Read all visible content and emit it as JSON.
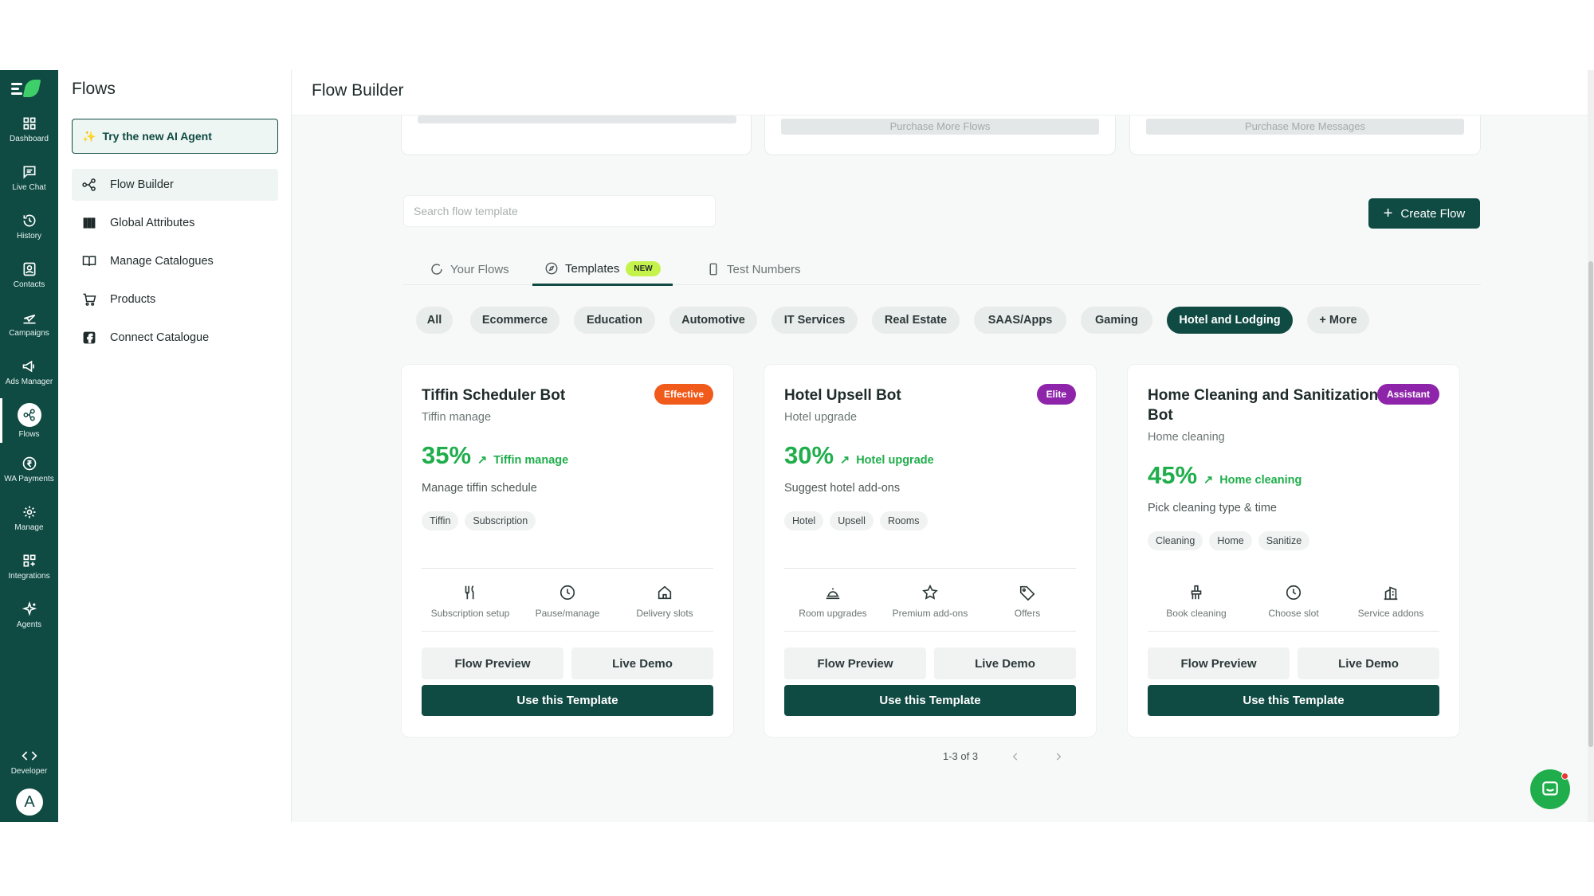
{
  "rail": {
    "items": [
      {
        "label": "Dashboard",
        "icon": "grid-icon"
      },
      {
        "label": "Live Chat",
        "icon": "chat-icon"
      },
      {
        "label": "History",
        "icon": "history-icon"
      },
      {
        "label": "Contacts",
        "icon": "contacts-icon"
      },
      {
        "label": "Campaigns",
        "icon": "send-icon"
      },
      {
        "label": "Ads Manager",
        "icon": "megaphone-icon"
      },
      {
        "label": "Flows",
        "icon": "flows-icon"
      },
      {
        "label": "WA Payments",
        "icon": "rupee-icon"
      },
      {
        "label": "Manage",
        "icon": "gear-icon"
      },
      {
        "label": "Integrations",
        "icon": "integrations-icon"
      },
      {
        "label": "Agents",
        "icon": "sparkle-icon"
      },
      {
        "label": "Developer",
        "icon": "code-icon"
      }
    ],
    "avatar": "A"
  },
  "side": {
    "title": "Flows",
    "ai_button": "Try the new AI Agent",
    "items": [
      "Flow Builder",
      "Global Attributes",
      "Manage Catalogues",
      "Products",
      "Connect Catalogue"
    ]
  },
  "header": {
    "title": "Flow Builder"
  },
  "top_cards": {
    "flows_button": "Purchase More Flows",
    "messages_button": "Purchase More Messages"
  },
  "search": {
    "placeholder": "Search flow template"
  },
  "create_button": "Create Flow",
  "tabs": {
    "your_flows": "Your Flows",
    "templates": "Templates",
    "new_badge": "NEW",
    "test_numbers": "Test Numbers"
  },
  "chips": [
    "All",
    "Ecommerce",
    "Education",
    "Automotive",
    "IT Services",
    "Real Estate",
    "SAAS/Apps",
    "Gaming",
    "Hotel and Lodging",
    "+ More"
  ],
  "cards": [
    {
      "title": "Tiffin Scheduler Bot",
      "badge": "Effective",
      "badge_color": "#f05a1a",
      "subtitle": "Tiffin manage",
      "percent": "35%",
      "trend": "Tiffin manage",
      "description": "Manage tiffin schedule",
      "tags": [
        "Tiffin",
        "Subscription"
      ],
      "features": [
        {
          "label": "Subscription setup",
          "icon": "utensils-icon"
        },
        {
          "label": "Pause/manage",
          "icon": "clock-icon"
        },
        {
          "label": "Delivery slots",
          "icon": "home-icon"
        }
      ],
      "preview": "Flow Preview",
      "demo": "Live Demo",
      "use": "Use this Template"
    },
    {
      "title": "Hotel Upsell Bot",
      "badge": "Elite",
      "badge_color": "#8e24aa",
      "subtitle": "Hotel upgrade",
      "percent": "30%",
      "trend": "Hotel upgrade",
      "description": "Suggest hotel add-ons",
      "tags": [
        "Hotel",
        "Upsell",
        "Rooms"
      ],
      "features": [
        {
          "label": "Room upgrades",
          "icon": "bell-icon"
        },
        {
          "label": "Premium add-ons",
          "icon": "star-icon"
        },
        {
          "label": "Offers",
          "icon": "tag-icon"
        }
      ],
      "preview": "Flow Preview",
      "demo": "Live Demo",
      "use": "Use this Template"
    },
    {
      "title": "Home Cleaning and Sanitization Bot",
      "badge": "Assistant",
      "badge_color": "#8e24aa",
      "subtitle": "Home cleaning",
      "percent": "45%",
      "trend": "Home cleaning",
      "description": "Pick cleaning type & time",
      "tags": [
        "Cleaning",
        "Home",
        "Sanitize"
      ],
      "features": [
        {
          "label": "Book cleaning",
          "icon": "brush-icon"
        },
        {
          "label": "Choose slot",
          "icon": "clock-icon"
        },
        {
          "label": "Service addons",
          "icon": "building-icon"
        }
      ],
      "preview": "Flow Preview",
      "demo": "Live Demo",
      "use": "Use this Template"
    }
  ],
  "pager": {
    "text": "1-3 of 3"
  },
  "colors": {
    "primary": "#0f4a43",
    "accent_green": "#1fae4b",
    "badge_lime": "#c6f24c"
  }
}
